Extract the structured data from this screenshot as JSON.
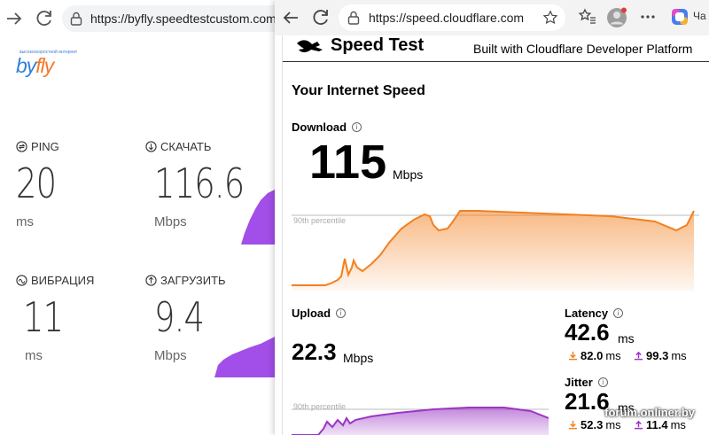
{
  "left": {
    "url": "https://byfly.speedtestcustom.com/",
    "logo": {
      "small_text": "высокоскоростной интернет",
      "text_by": "by",
      "text_fly": "fly"
    },
    "metrics": [
      {
        "label": "PING",
        "value": "20",
        "unit": "ms",
        "icon": "ping-icon"
      },
      {
        "label": "СКАЧАТЬ",
        "value": "116.6",
        "unit": "Mbps",
        "icon": "download-icon"
      },
      {
        "label": "ВИБРАЦИЯ",
        "value": "11",
        "unit": "ms",
        "icon": "jitter-icon"
      },
      {
        "label": "ЗАГРУЗИТЬ",
        "value": "9.4",
        "unit": "Mbps",
        "icon": "upload-icon"
      }
    ],
    "chart_color": "#a24ee8"
  },
  "right": {
    "url": "https://speed.cloudflare.com",
    "tab_label": "Ча",
    "brand_title": "Speed Test",
    "brand_subtitle": "Built with Cloudflare Developer Platform",
    "section_title": "Your Internet Speed",
    "download": {
      "label": "Download",
      "value": "115",
      "unit": "Mbps",
      "percentile_label": "90th percentile",
      "color": "#f38020"
    },
    "upload": {
      "label": "Upload",
      "value": "22.3",
      "unit": "Mbps",
      "percentile_label": "90th percentile",
      "color": "#9b36c4"
    },
    "latency": {
      "label": "Latency",
      "value": "42.6",
      "unit": "ms",
      "down_value": "82.0",
      "down_unit": "ms",
      "up_value": "99.3",
      "up_unit": "ms"
    },
    "jitter": {
      "label": "Jitter",
      "value": "21.6",
      "unit": "ms",
      "down_value": "52.3",
      "down_unit": "ms",
      "up_value": "11.4",
      "up_unit": "ms"
    }
  },
  "watermark": "forum.onliner.by"
}
